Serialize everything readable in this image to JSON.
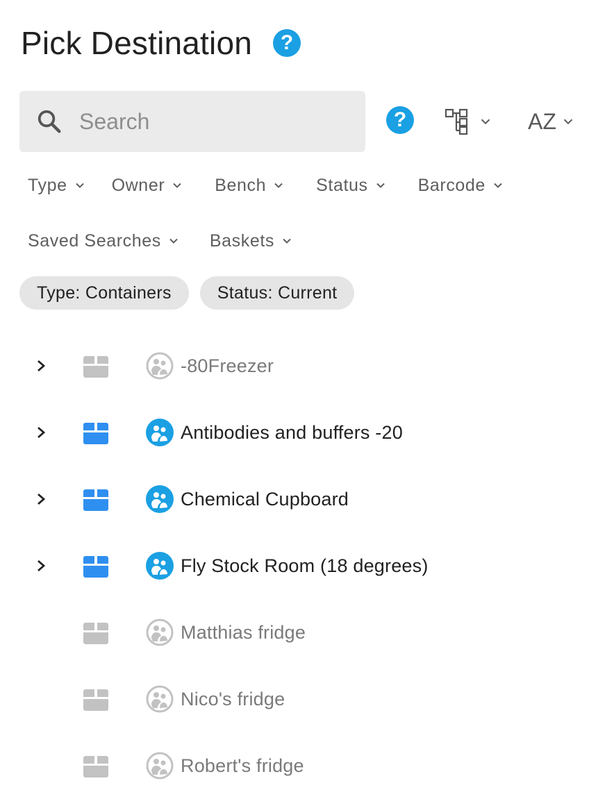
{
  "header": {
    "title": "Pick Destination"
  },
  "search": {
    "placeholder": "Search",
    "value": ""
  },
  "toolbar": {
    "sort_label": "AZ"
  },
  "filters_row1": [
    "Type",
    "Owner",
    "Bench",
    "Status",
    "Barcode"
  ],
  "filters_row2": [
    "Saved Searches",
    "Baskets"
  ],
  "chips": [
    "Type: Containers",
    "Status: Current"
  ],
  "colors": {
    "accent": "#1aa0e3",
    "container_active": "#2f8ff0",
    "container_inactive": "#c2c2c2"
  },
  "items": [
    {
      "label": "-80Freezer",
      "expandable": true,
      "active": false
    },
    {
      "label": "Antibodies and buffers -20",
      "expandable": true,
      "active": true
    },
    {
      "label": "Chemical Cupboard",
      "expandable": true,
      "active": true
    },
    {
      "label": "Fly Stock Room (18 degrees)",
      "expandable": true,
      "active": true
    },
    {
      "label": "Matthias fridge",
      "expandable": false,
      "active": false
    },
    {
      "label": "Nico's fridge",
      "expandable": false,
      "active": false
    },
    {
      "label": "Robert's fridge",
      "expandable": false,
      "active": false
    }
  ]
}
